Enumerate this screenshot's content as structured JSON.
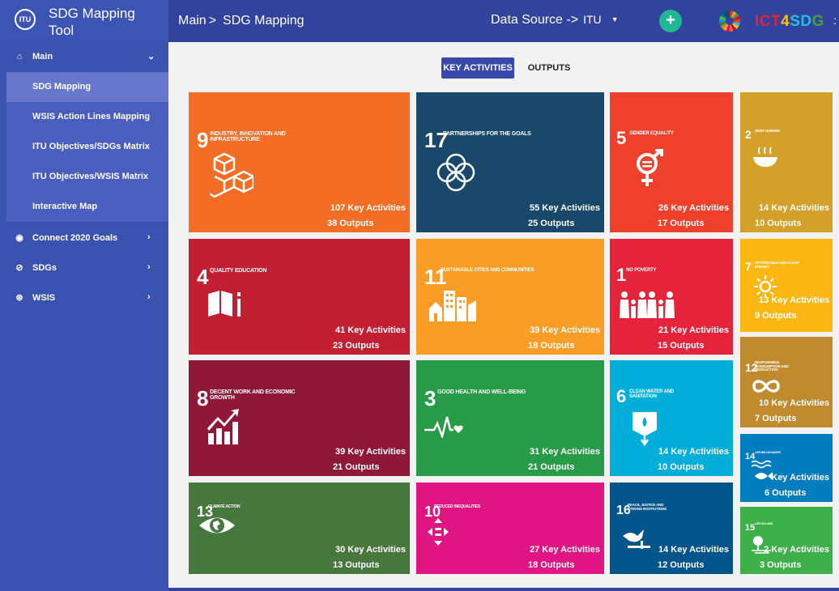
{
  "header": {
    "app_title_line1": "SDG Mapping",
    "app_title_line2": "Tool",
    "logo_text": "ITU",
    "breadcrumb_root": "Main",
    "breadcrumb_sep": ">",
    "breadcrumb_current": "SDG Mapping",
    "data_source_label": "Data Source ->",
    "data_source_value": "ITU",
    "add_label": "+",
    "ict_parts": [
      "ICT",
      "4",
      "SD",
      "G"
    ],
    "trailing": ":"
  },
  "sidebar": {
    "main": "Main",
    "sub_items": [
      "SDG Mapping",
      "WSIS Action Lines Mapping",
      "ITU Objectives/SDGs Matrix",
      "ITU Objectives/WSIS Matrix",
      "Interactive Map"
    ],
    "groups": [
      "Connect 2020 Goals",
      "SDGs",
      "WSIS"
    ],
    "icons": [
      "home-icon",
      "globe-icon",
      "compass-icon",
      "network-icon"
    ]
  },
  "tabs": {
    "active": "KEY ACTIVITIES",
    "inactive": "OUTPUTS"
  },
  "tiles": [
    {
      "num": "9",
      "name": "Industry, Innovation and Infrastructure",
      "ka": "107 Key Activities",
      "op": "38 Outputs",
      "color": "#f36d25",
      "icon": "cubes-icon"
    },
    {
      "num": "17",
      "name": "Partnerships for the Goals",
      "ka": "55 Key Activities",
      "op": "25 Outputs",
      "color": "#19486a",
      "icon": "rings-icon"
    },
    {
      "num": "5",
      "name": "Gender Equality",
      "ka": "26 Key Activities",
      "op": "17 Outputs",
      "color": "#ef402b",
      "icon": "gender-icon"
    },
    {
      "num": "2",
      "name": "Zero Hunger",
      "ka": "14 Key Activities",
      "op": "10 Outputs",
      "color": "#d3a029",
      "icon": "bowl-icon"
    },
    {
      "num": "4",
      "name": "Quality Education",
      "ka": "41 Key Activities",
      "op": "23 Outputs",
      "color": "#c31f33",
      "icon": "book-icon"
    },
    {
      "num": "11",
      "name": "Sustainable Cities and Communities",
      "ka": "39 Key Activities",
      "op": "18 Outputs",
      "color": "#f99d26",
      "icon": "city-icon"
    },
    {
      "num": "1",
      "name": "No Poverty",
      "ka": "21 Key Activities",
      "op": "15 Outputs",
      "color": "#e5243b",
      "icon": "family-icon"
    },
    {
      "num": "7",
      "name": "Affordable and Clean Energy",
      "ka": "13 Key Activities",
      "op": "9 Outputs",
      "color": "#fdb713",
      "icon": "sun-icon"
    },
    {
      "num": "12",
      "name": "Responsible Consumption and Production",
      "ka": "10 Key Activities",
      "op": "7 Outputs",
      "color": "#bf8b2e",
      "icon": "infinity-icon"
    },
    {
      "num": "8",
      "name": "Decent Work and Economic Growth",
      "ka": "39 Key Activities",
      "op": "21 Outputs",
      "color": "#8f1838",
      "icon": "growth-icon"
    },
    {
      "num": "3",
      "name": "Good Health and Well-Being",
      "ka": "31 Key Activities",
      "op": "21 Outputs",
      "color": "#279b48",
      "icon": "heartbeat-icon"
    },
    {
      "num": "6",
      "name": "Clean Water and Sanitation",
      "ka": "14 Key Activities",
      "op": "10 Outputs",
      "color": "#00aed9",
      "icon": "water-icon"
    },
    {
      "num": "14",
      "name": "Life Below Water",
      "ka": "Key Activities",
      "op": "6 Outputs",
      "color": "#007dbc",
      "icon": "fish-icon"
    },
    {
      "num": "13",
      "name": "Climate Action",
      "ka": "30 Key Activities",
      "op": "13 Outputs",
      "color": "#48773e",
      "icon": "eye-globe-icon"
    },
    {
      "num": "10",
      "name": "Reduced Inequalities",
      "ka": "27 Key Activities",
      "op": "18 Outputs",
      "color": "#e01483",
      "icon": "equal-icon"
    },
    {
      "num": "16",
      "name": "Peace, Justice and Strong Institutions",
      "ka": "14 Key Activities",
      "op": "12 Outputs",
      "color": "#02558b",
      "icon": "dove-icon"
    },
    {
      "num": "15",
      "name": "Life on Land",
      "ka": "2 Key Activities",
      "op": "3 Outputs",
      "color": "#3eb049",
      "icon": "tree-icon"
    }
  ]
}
